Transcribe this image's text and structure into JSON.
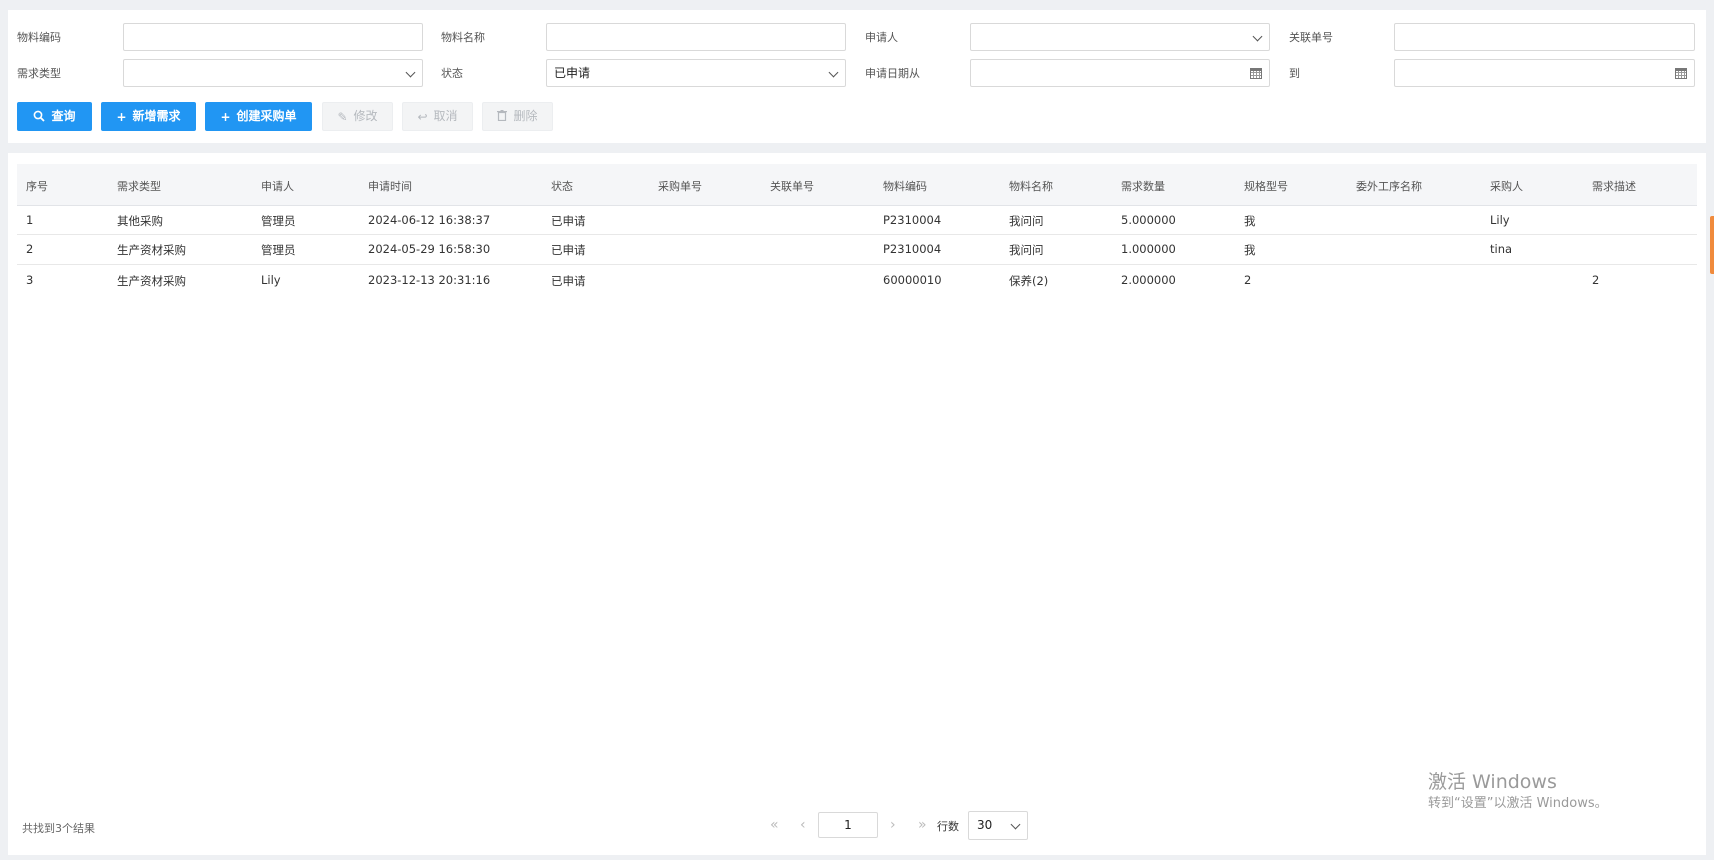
{
  "filters": {
    "material_code_label": "物料编码",
    "material_name_label": "物料名称",
    "applicant_label": "申请人",
    "related_no_label": "关联单号",
    "demand_type_label": "需求类型",
    "status_label": "状态",
    "status_value": "已申请",
    "date_from_label": "申请日期从",
    "date_to_label": "到"
  },
  "toolbar": {
    "query": "查询",
    "add_demand": "新增需求",
    "create_po": "创建采购单",
    "edit": "修改",
    "cancel": "取消",
    "delete": "删除"
  },
  "table": {
    "columns": [
      "序号",
      "需求类型",
      "申请人",
      "申请时间",
      "状态",
      "采购单号",
      "关联单号",
      "物料编码",
      "物料名称",
      "需求数量",
      "规格型号",
      "委外工序名称",
      "采购人",
      "需求描述"
    ],
    "rows": [
      [
        "1",
        "其他采购",
        "管理员",
        "2024-06-12 16:38:37",
        "已申请",
        "",
        "",
        "P2310004",
        "我问问",
        "5.000000",
        "我",
        "",
        "Lily",
        ""
      ],
      [
        "2",
        "生产资材采购",
        "管理员",
        "2024-05-29 16:58:30",
        "已申请",
        "",
        "",
        "P2310004",
        "我问问",
        "1.000000",
        "我",
        "",
        "tina",
        ""
      ],
      [
        "3",
        "生产资材采购",
        "Lily",
        "2023-12-13 20:31:16",
        "已申请",
        "",
        "",
        "60000010",
        "保养(2)",
        "2.000000",
        "2",
        "",
        "",
        "2"
      ]
    ]
  },
  "footer": {
    "result_count": "共找到3个结果",
    "page": "1",
    "rows_label": "行数",
    "rows_value": "30"
  },
  "watermark": {
    "title": "激活 Windows",
    "subtitle": "转到“设置”以激活 Windows。"
  },
  "colors": {
    "primary": "#2196f3",
    "scroll_accent": "#f08a3c"
  }
}
